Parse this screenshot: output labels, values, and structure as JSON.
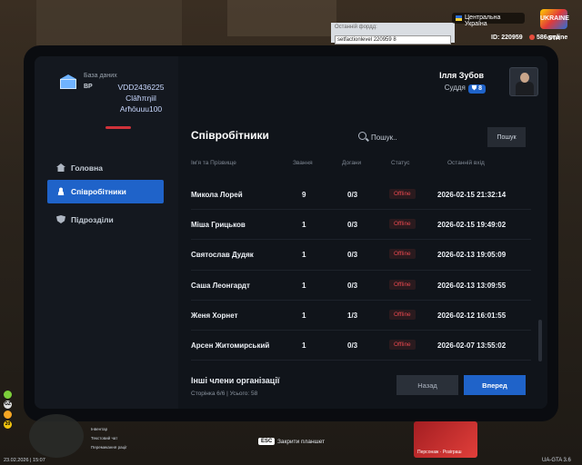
{
  "hud": {
    "chat_hint": "Останній фордд:",
    "chat_input": "setfactionlevel 220959 8",
    "server_name": "Центральна Україна",
    "logo_text": "UKRAINE GTA",
    "player_id": "ID: 220959",
    "online": "586 online",
    "esc_key": "ESC",
    "esc_label": "Закрити планшет",
    "date": "23.02.2026 | 15:07",
    "version": "UA-GTA 3.6",
    "hints": [
      "Інвентар",
      "Текстовий чат",
      "Перемикання рації"
    ],
    "stats": [
      "GZ",
      "20"
    ],
    "promo": "Персонаж · Розіграш"
  },
  "sidebar": {
    "db_label": "База даних",
    "db_org": "ВР",
    "db_lines": [
      "VDD2436225",
      "Clāħπηiil",
      "Arħōuuu100"
    ],
    "nav": [
      {
        "label": "Головна",
        "icon": "home-icon"
      },
      {
        "label": "Співробітники",
        "icon": "users-icon"
      },
      {
        "label": "Підрозділи",
        "icon": "shield-icon"
      }
    ]
  },
  "user": {
    "name": "Ілля Зубов",
    "role": "Суддя",
    "rank": "8"
  },
  "main": {
    "title": "Співробітники",
    "search_placeholder": "Пошук..",
    "search_button": "Пошук",
    "columns": [
      "Ім'я та Прізвище",
      "Звання",
      "Догани",
      "Статус",
      "Останній вхід"
    ],
    "rows": [
      {
        "name": "Микола Лорей",
        "rank": "9",
        "warns": "0/3",
        "status": "Offline",
        "last": "2026-02-15 21:32:14"
      },
      {
        "name": "Міша Грицьков",
        "rank": "1",
        "warns": "0/3",
        "status": "Offline",
        "last": "2026-02-15 19:49:02"
      },
      {
        "name": "Святослав Дудяк",
        "rank": "1",
        "warns": "0/3",
        "status": "Offline",
        "last": "2026-02-13 19:05:09"
      },
      {
        "name": "Саша Леонгардт",
        "rank": "1",
        "warns": "0/3",
        "status": "Offline",
        "last": "2026-02-13 13:09:55"
      },
      {
        "name": "Женя Хорнет",
        "rank": "1",
        "warns": "1/3",
        "status": "Offline",
        "last": "2026-02-12 16:01:55"
      },
      {
        "name": "Арсен Житомирський",
        "rank": "1",
        "warns": "0/3",
        "status": "Offline",
        "last": "2026-02-07 13:55:02"
      }
    ],
    "footer_title": "Інші члени організації",
    "footer_meta": "Сторінка 6/6 | Усього: 58",
    "back_button": "Назад",
    "forward_button": "Вперед"
  },
  "colors": {
    "accent": "#1f63c9",
    "danger": "#e8484f",
    "panel": "#14181f"
  }
}
